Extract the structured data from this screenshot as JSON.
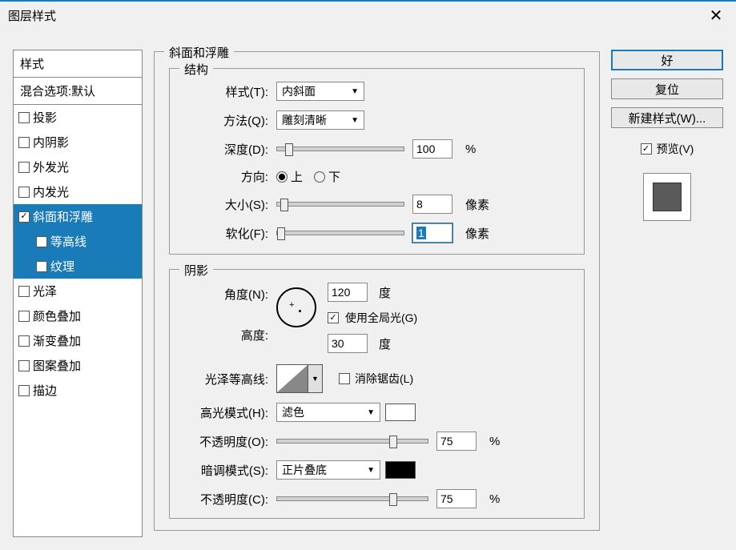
{
  "window": {
    "title": "图层样式"
  },
  "sidebar": {
    "header": "样式",
    "blend": "混合选项:默认",
    "items": [
      {
        "label": "投影",
        "checked": false,
        "selected": false
      },
      {
        "label": "内阴影",
        "checked": false,
        "selected": false
      },
      {
        "label": "外发光",
        "checked": false,
        "selected": false
      },
      {
        "label": "内发光",
        "checked": false,
        "selected": false
      },
      {
        "label": "斜面和浮雕",
        "checked": true,
        "selected": true
      },
      {
        "label": "等高线",
        "checked": false,
        "selected": true,
        "sub": true
      },
      {
        "label": "纹理",
        "checked": false,
        "selected": true,
        "sub": true
      },
      {
        "label": "光泽",
        "checked": false,
        "selected": false
      },
      {
        "label": "颜色叠加",
        "checked": false,
        "selected": false
      },
      {
        "label": "渐变叠加",
        "checked": false,
        "selected": false
      },
      {
        "label": "图案叠加",
        "checked": false,
        "selected": false
      },
      {
        "label": "描边",
        "checked": false,
        "selected": false
      }
    ]
  },
  "main": {
    "title": "斜面和浮雕",
    "structure": {
      "title": "结构",
      "style_label": "样式(T):",
      "style_value": "内斜面",
      "method_label": "方法(Q):",
      "method_value": "雕刻清晰",
      "depth_label": "深度(D):",
      "depth_value": "100",
      "depth_unit": "%",
      "direction_label": "方向:",
      "direction_up": "上",
      "direction_down": "下",
      "size_label": "大小(S):",
      "size_value": "8",
      "size_unit": "像素",
      "soften_label": "软化(F):",
      "soften_value": "1",
      "soften_unit": "像素"
    },
    "shadow": {
      "title": "阴影",
      "angle_label": "角度(N):",
      "angle_value": "120",
      "angle_unit": "度",
      "global_light": "使用全局光(G)",
      "altitude_label": "高度:",
      "altitude_value": "30",
      "altitude_unit": "度",
      "gloss_label": "光泽等高线:",
      "antialias": "消除锯齿(L)",
      "highlight_mode_label": "高光模式(H):",
      "highlight_mode_value": "滤色",
      "highlight_color": "#ffffff",
      "highlight_opacity_label": "不透明度(O):",
      "highlight_opacity_value": "75",
      "highlight_opacity_unit": "%",
      "shadow_mode_label": "暗调模式(S):",
      "shadow_mode_value": "正片叠底",
      "shadow_color": "#000000",
      "shadow_opacity_label": "不透明度(C):",
      "shadow_opacity_value": "75",
      "shadow_opacity_unit": "%"
    }
  },
  "buttons": {
    "ok": "好",
    "reset": "复位",
    "new_style": "新建样式(W)...",
    "preview": "预览(V)"
  }
}
